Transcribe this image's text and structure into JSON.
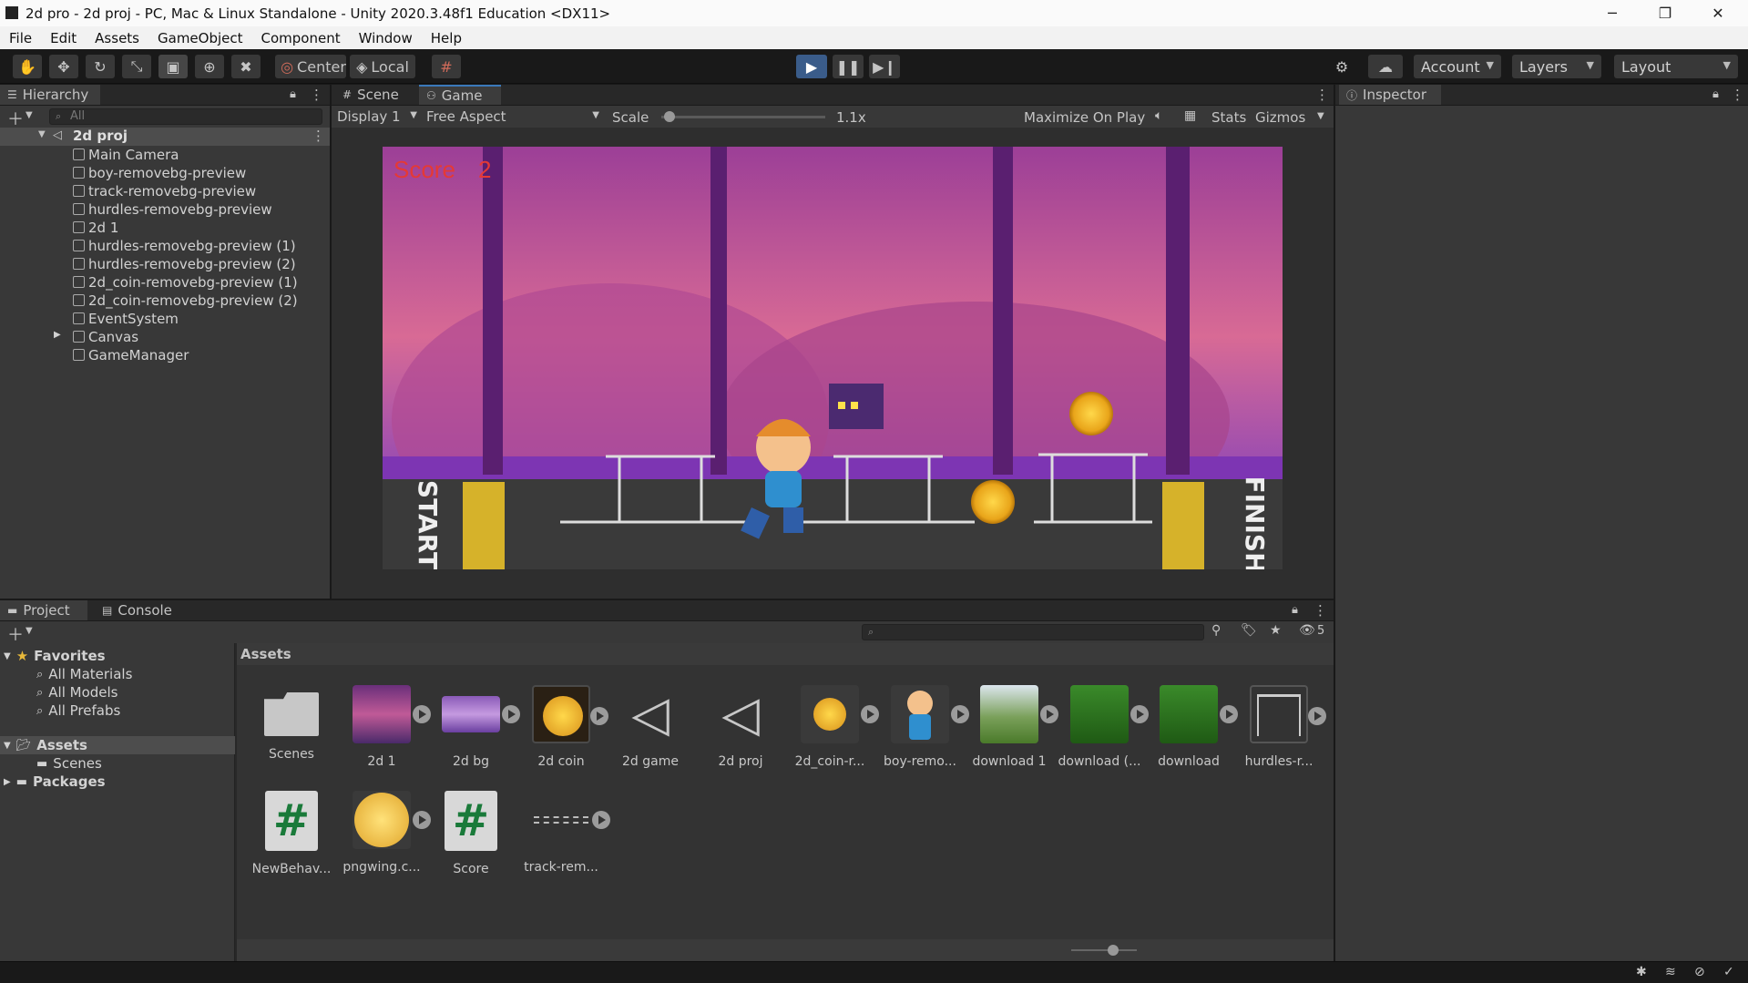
{
  "window": {
    "title": "2d pro - 2d proj - PC, Mac & Linux Standalone - Unity 2020.3.48f1 Education <DX11>",
    "minimize": "─",
    "maximize": "❐",
    "close": "✕"
  },
  "menu": [
    "File",
    "Edit",
    "Assets",
    "GameObject",
    "Component",
    "Window",
    "Help"
  ],
  "toolbar": {
    "pivot": "Center",
    "space": "Local",
    "account": "Account",
    "layers": "Layers",
    "layout": "Layout"
  },
  "hierarchy": {
    "tab": "Hierarchy",
    "search_placeholder": "All",
    "scene": "2d proj",
    "items": [
      "Main Camera",
      "boy-removebg-preview",
      "track-removebg-preview",
      "hurdles-removebg-preview",
      "2d 1",
      "hurdles-removebg-preview (1)",
      "hurdles-removebg-preview (2)",
      "2d_coin-removebg-preview (1)",
      "2d_coin-removebg-preview (2)",
      "EventSystem",
      "Canvas",
      "GameManager"
    ]
  },
  "game_view": {
    "tabs": [
      "Scene",
      "Game"
    ],
    "display": "Display 1",
    "aspect": "Free Aspect",
    "scale_label": "Scale",
    "scale_value": "1.1x",
    "scale_level": 0.05,
    "maximize": "Maximize On Play",
    "stats": "Stats",
    "gizmos": "Gizmos",
    "score_label": "Score",
    "score_value": "2",
    "start_text": "START",
    "finish_text": "FINISH"
  },
  "inspector": {
    "tab": "Inspector"
  },
  "project": {
    "tabs": [
      "Project",
      "Console"
    ],
    "hidden_count": "5",
    "favorites": "Favorites",
    "favorite_items": [
      "All Materials",
      "All Models",
      "All Prefabs"
    ],
    "assets_root": "Assets",
    "scenes": "Scenes",
    "packages": "Packages",
    "breadcrumb": "Assets",
    "assets": [
      {
        "label": "Scenes"
      },
      {
        "label": "2d 1"
      },
      {
        "label": "2d bg"
      },
      {
        "label": "2d coin"
      },
      {
        "label": "2d game"
      },
      {
        "label": "2d proj"
      },
      {
        "label": "2d_coin-r..."
      },
      {
        "label": "boy-remo..."
      },
      {
        "label": "download 1"
      },
      {
        "label": "download (..."
      },
      {
        "label": "download"
      },
      {
        "label": "hurdles-r..."
      },
      {
        "label": "NewBehav..."
      },
      {
        "label": "pngwing.c..."
      },
      {
        "label": "Score"
      },
      {
        "label": "track-rem..."
      }
    ]
  },
  "colors": {
    "accent": "#3a79bb",
    "play_active": "#3a5c8a",
    "score_text": "#e53935"
  }
}
